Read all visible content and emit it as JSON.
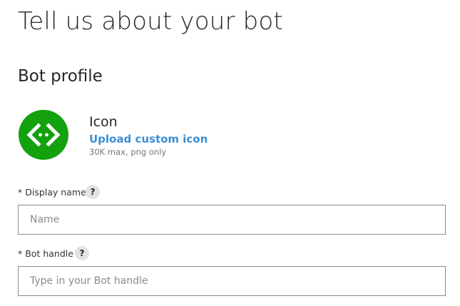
{
  "page": {
    "title": "Tell us about your bot"
  },
  "profile": {
    "section_title": "Bot profile",
    "icon_label": "Icon",
    "upload_link": "Upload custom icon",
    "upload_hint": "30K max, png only",
    "avatar_color": "#13a10e",
    "avatar_icon": "code-brackets-icon"
  },
  "fields": {
    "display_name": {
      "label": "* Display name",
      "help": "?",
      "placeholder": "Name",
      "value": ""
    },
    "bot_handle": {
      "label": "* Bot handle",
      "help": "?",
      "placeholder": "Type in your Bot handle",
      "value": ""
    }
  },
  "colors": {
    "link": "#3a8fd6",
    "input_border": "#8a8a8a",
    "help_bg": "#e3e3e3"
  }
}
